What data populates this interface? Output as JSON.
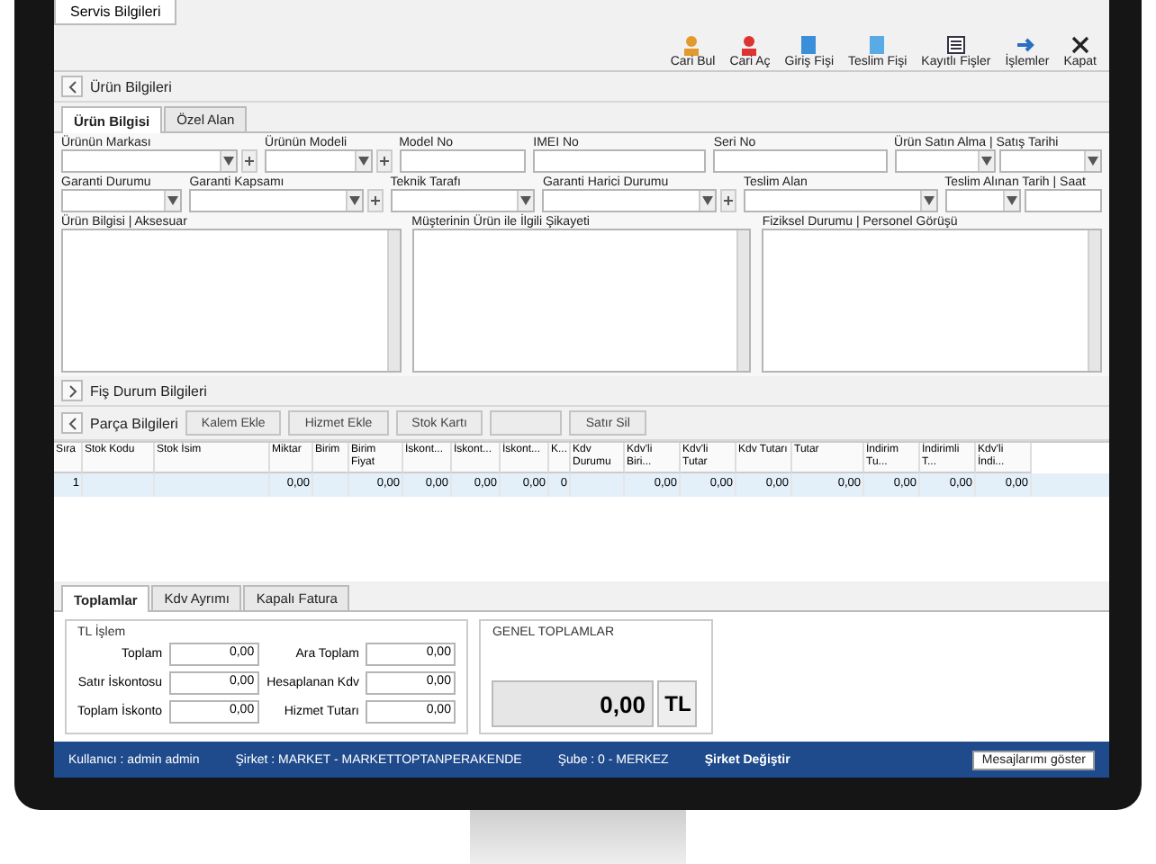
{
  "window": {
    "tab": "Servis Bilgileri"
  },
  "toolbar": [
    {
      "label": "Cari Bul"
    },
    {
      "label": "Cari Aç"
    },
    {
      "label": "Giriş Fişi"
    },
    {
      "label": "Teslim Fişi"
    },
    {
      "label": "Kayıtlı Fişler"
    },
    {
      "label": "İşlemler"
    },
    {
      "label": "Kapat"
    }
  ],
  "product_section": {
    "title": "Ürün Bilgileri",
    "expanded": true,
    "tabs": [
      {
        "label": "Ürün Bilgisi",
        "selected": true
      },
      {
        "label": "Özel Alan",
        "selected": false
      }
    ],
    "row_1": [
      {
        "label": "Ürünün Markası",
        "kind": "combo_plus"
      },
      {
        "label": "Ürünün Modeli",
        "kind": "combo_plus"
      },
      {
        "label": "Model No",
        "kind": "text"
      },
      {
        "label": "IMEI No",
        "kind": "text"
      },
      {
        "label": "Seri No",
        "kind": "text"
      },
      {
        "label": "Ürün Satın Alma | Satış Tarihi",
        "kind": "date_pair"
      }
    ],
    "row_2": [
      {
        "label": "Garanti Durumu",
        "kind": "combo"
      },
      {
        "label": "Garanti Kapsamı",
        "kind": "combo_plus"
      },
      {
        "label": "Teknik Tarafı",
        "kind": "combo"
      },
      {
        "label": "Garanti Harici Durumu",
        "kind": "combo_plus"
      },
      {
        "label": "Teslim Alan",
        "kind": "combo"
      },
      {
        "label": "Teslim Alınan Tarih | Saat",
        "kind": "date_time"
      }
    ],
    "notes": [
      {
        "label": "Ürün Bilgisi | Aksesuar"
      },
      {
        "label": "Müşterinin Ürün ile İlgili Şikayeti"
      },
      {
        "label": "Fiziksel Durumu | Personel Görüşü"
      }
    ]
  },
  "receipt_section": {
    "title": "Fiş Durum Bilgileri",
    "expanded": false
  },
  "parts_section": {
    "title": "Parça Bilgileri",
    "expanded": true,
    "buttons": [
      {
        "kind": "labeled",
        "label": "Kalem Ekle"
      },
      {
        "kind": "labeled",
        "label": "Hizmet Ekle"
      },
      {
        "kind": "labeled",
        "label": "Stok Kartı"
      },
      {
        "kind": "blank"
      },
      {
        "kind": "labeled",
        "label": "Satır Sil"
      }
    ],
    "columns": [
      "Sıra",
      "Stok Kodu",
      "Stok İsim",
      "Miktar",
      "Birim",
      "Birim Fiyat",
      "İskont...",
      "İskont...",
      "İskont...",
      "K...",
      "Kdv Durumu",
      "Kdv'li Biri...",
      "Kdv'li Tutar",
      "Kdv Tutarı",
      "Tutar",
      "İndirim Tu...",
      "İndirimli T...",
      "Kdv'li İndi..."
    ],
    "rows": [
      {
        "selected": true,
        "cells": [
          "1",
          "",
          "",
          "0,00",
          "",
          "0,00",
          "0,00",
          "0,00",
          "0,00",
          "0",
          "",
          "0,00",
          "0,00",
          "0,00",
          "0,00",
          "0,00",
          "0,00",
          "0,00"
        ]
      }
    ]
  },
  "bottom_tabs": [
    {
      "label": "Toplamlar",
      "selected": true
    },
    {
      "label": "Kdv Ayrımı",
      "selected": false
    },
    {
      "label": "Kapalı Fatura",
      "selected": false
    }
  ],
  "tl_group": {
    "title": "TL İşlem",
    "left": [
      {
        "label": "Toplam",
        "value": "0,00"
      },
      {
        "label": "Satır İskontosu",
        "value": "0,00"
      },
      {
        "label": "Toplam İskonto",
        "value": "0,00"
      }
    ],
    "right": [
      {
        "label": "Ara Toplam",
        "value": "0,00"
      },
      {
        "label": "Hesaplanan Kdv",
        "value": "0,00"
      },
      {
        "label": "Hizmet Tutarı",
        "value": "0,00"
      }
    ]
  },
  "grand_total": {
    "title": "GENEL TOPLAMLAR",
    "value": "0,00",
    "currency": "TL"
  },
  "status_bar": {
    "items": [
      {
        "text": "Kullanıcı : admin admin",
        "kind": "info"
      },
      {
        "text": "Şirket : MARKET - MARKETTOPTANPERAKENDE",
        "kind": "info"
      },
      {
        "text": "Şube : 0 - MERKEZ",
        "kind": "info"
      },
      {
        "text": "Şirket Değiştir",
        "kind": "link"
      }
    ],
    "button": "Mesajlarımı göster"
  }
}
